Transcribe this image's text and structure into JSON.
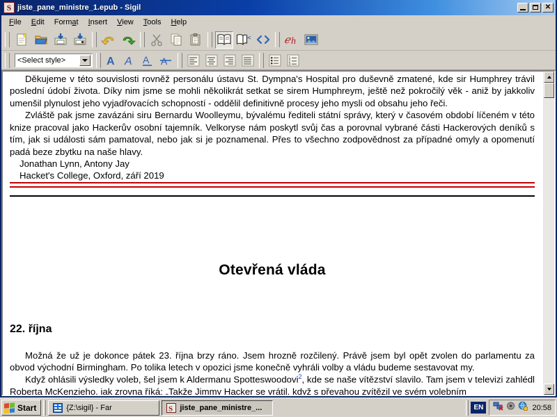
{
  "window": {
    "title": "jiste_pane_ministre_1.epub - Sigil",
    "logo": "sigil-s-logo",
    "buttons": {
      "minimize": "minimize-button",
      "maximize": "maximize-button",
      "close_label": "✕"
    }
  },
  "menubar": {
    "items": [
      {
        "label": "File",
        "mnemonic": "F"
      },
      {
        "label": "Edit",
        "mnemonic": "E"
      },
      {
        "label": "Format",
        "mnemonic": "a"
      },
      {
        "label": "Insert",
        "mnemonic": "I"
      },
      {
        "label": "View",
        "mnemonic": "V"
      },
      {
        "label": "Tools",
        "mnemonic": "T"
      },
      {
        "label": "Help",
        "mnemonic": "H"
      }
    ]
  },
  "toolbar_main": {
    "groups": [
      {
        "buttons": [
          {
            "name": "new-file-icon",
            "title": "New"
          },
          {
            "name": "open-folder-icon",
            "title": "Open"
          },
          {
            "name": "save-icon",
            "title": "Save"
          },
          {
            "name": "save-as-icon",
            "title": "Save As"
          }
        ]
      },
      {
        "buttons": [
          {
            "name": "undo-icon",
            "title": "Undo"
          },
          {
            "name": "redo-icon",
            "title": "Redo"
          }
        ]
      },
      {
        "buttons": [
          {
            "name": "cut-scissors-icon",
            "title": "Cut"
          },
          {
            "name": "copy-icon",
            "title": "Copy"
          },
          {
            "name": "paste-clipboard-icon",
            "title": "Paste"
          }
        ]
      },
      {
        "buttons": [
          {
            "name": "book-view-icon",
            "title": "Book View",
            "pressed": true
          },
          {
            "name": "split-view-icon",
            "title": "Split View"
          },
          {
            "name": "code-view-icon",
            "title": "Code View"
          }
        ]
      },
      {
        "buttons": [
          {
            "name": "special-character-icon",
            "title": "Insert Special Character"
          },
          {
            "name": "insert-image-icon",
            "title": "Insert Image"
          }
        ]
      }
    ]
  },
  "toolbar_format": {
    "style_select": {
      "value": "<Select style>",
      "name": "style-select"
    },
    "text_buttons": [
      {
        "name": "bold-icon",
        "title": "Bold",
        "glyph": "A"
      },
      {
        "name": "italic-icon",
        "title": "Italic",
        "glyph": "A"
      },
      {
        "name": "underline-icon",
        "title": "Underline",
        "glyph": "A"
      },
      {
        "name": "strikethrough-icon",
        "title": "Strikethrough",
        "glyph": "A"
      }
    ],
    "align_buttons": [
      {
        "name": "align-left-icon",
        "title": "Align Left"
      },
      {
        "name": "align-center-icon",
        "title": "Align Center"
      },
      {
        "name": "align-right-icon",
        "title": "Align Right"
      },
      {
        "name": "align-justify-icon",
        "title": "Justify"
      }
    ],
    "list_buttons": [
      {
        "name": "bullet-list-icon",
        "title": "Bulleted List"
      },
      {
        "name": "numbered-list-icon",
        "title": "Numbered List"
      }
    ]
  },
  "document": {
    "paragraph_1": "Děkujeme v této souvislosti rovněž personálu ústavu St. Dympna's Hospital pro duševně zmatené, kde sir Humphrey trávil poslední údobí života. Díky nim jsme se mohli několikrát setkat se sirem Humphreym, ještě než pokročilý věk - aniž by jakkoliv umenšil plynulost jeho vyjadřovacích schopností - oddělil definitivně procesy jeho mysli od obsahu jeho řeči.",
    "paragraph_2": "Zvláště pak jsme zavázáni siru Bernardu Woolleymu, bývalému řediteli státní správy, který v časovém období líčeném v této knize pracoval jako Hackerův osobní tajemník. Velkoryse nám poskytl svůj čas a porovnal vybrané části Hackerových deníků s tím, jak si události sám pamatoval, nebo jak si je poznamenal. Přes to všechno zodpovědnost za případné omyly a opomenutí padá beze zbytku na naše hlavy.",
    "signature_1": "Jonathan Lynn, Antony Jay",
    "signature_2": "Hacket's College, Oxford, září 2019",
    "chapter_title": "Otevřená vláda",
    "chapter_date": "22. října",
    "paragraph_3": "Možná že už je dokonce pátek 23. října brzy ráno. Jsem hrozně rozčilený. Právě jsem byl opět zvolen do parlamentu za obvod východní Birmingham. Po tolika letech v opozici jsme konečně vyhráli volby a vládu budeme sestavovat my.",
    "paragraph_4_a": "Když ohlásili výsledky voleb, šel jsem k Aldermanu Spotteswoodovi",
    "paragraph_4_note": "2",
    "paragraph_4_b": ", kde se naše vítězství slavilo. Tam jsem v televizi zahlédl Roberta McKenzieho, jak zrovna říká: „Takže Jimmy Hacker se vrátil, když s převahou zvítězil ve svém volebním"
  },
  "scrollbar": {
    "up_arrow": "scroll-up-arrow",
    "down_arrow": "scroll-down-arrow",
    "thumb": "scroll-thumb"
  },
  "taskbar": {
    "start_label": "Start",
    "tasks": [
      {
        "label": "{Z:\\sigil} - Far",
        "icon": "far-manager-icon",
        "active": false
      },
      {
        "label": "jiste_pane_ministre_...",
        "icon": "sigil-s-logo",
        "active": true
      }
    ],
    "tray": {
      "language": "EN",
      "icons": [
        {
          "name": "network-disconnected-icon"
        },
        {
          "name": "volume-icon"
        },
        {
          "name": "security-shield-icon"
        }
      ],
      "time": "20:58"
    }
  },
  "colors": {
    "title_start": "#0a246a",
    "title_end": "#a6caf0",
    "chrome": "#d4d0c8",
    "hr_red": "#c00000",
    "note_blue": "#1a3fd0",
    "accent_sigil": "#8b1a1a"
  }
}
